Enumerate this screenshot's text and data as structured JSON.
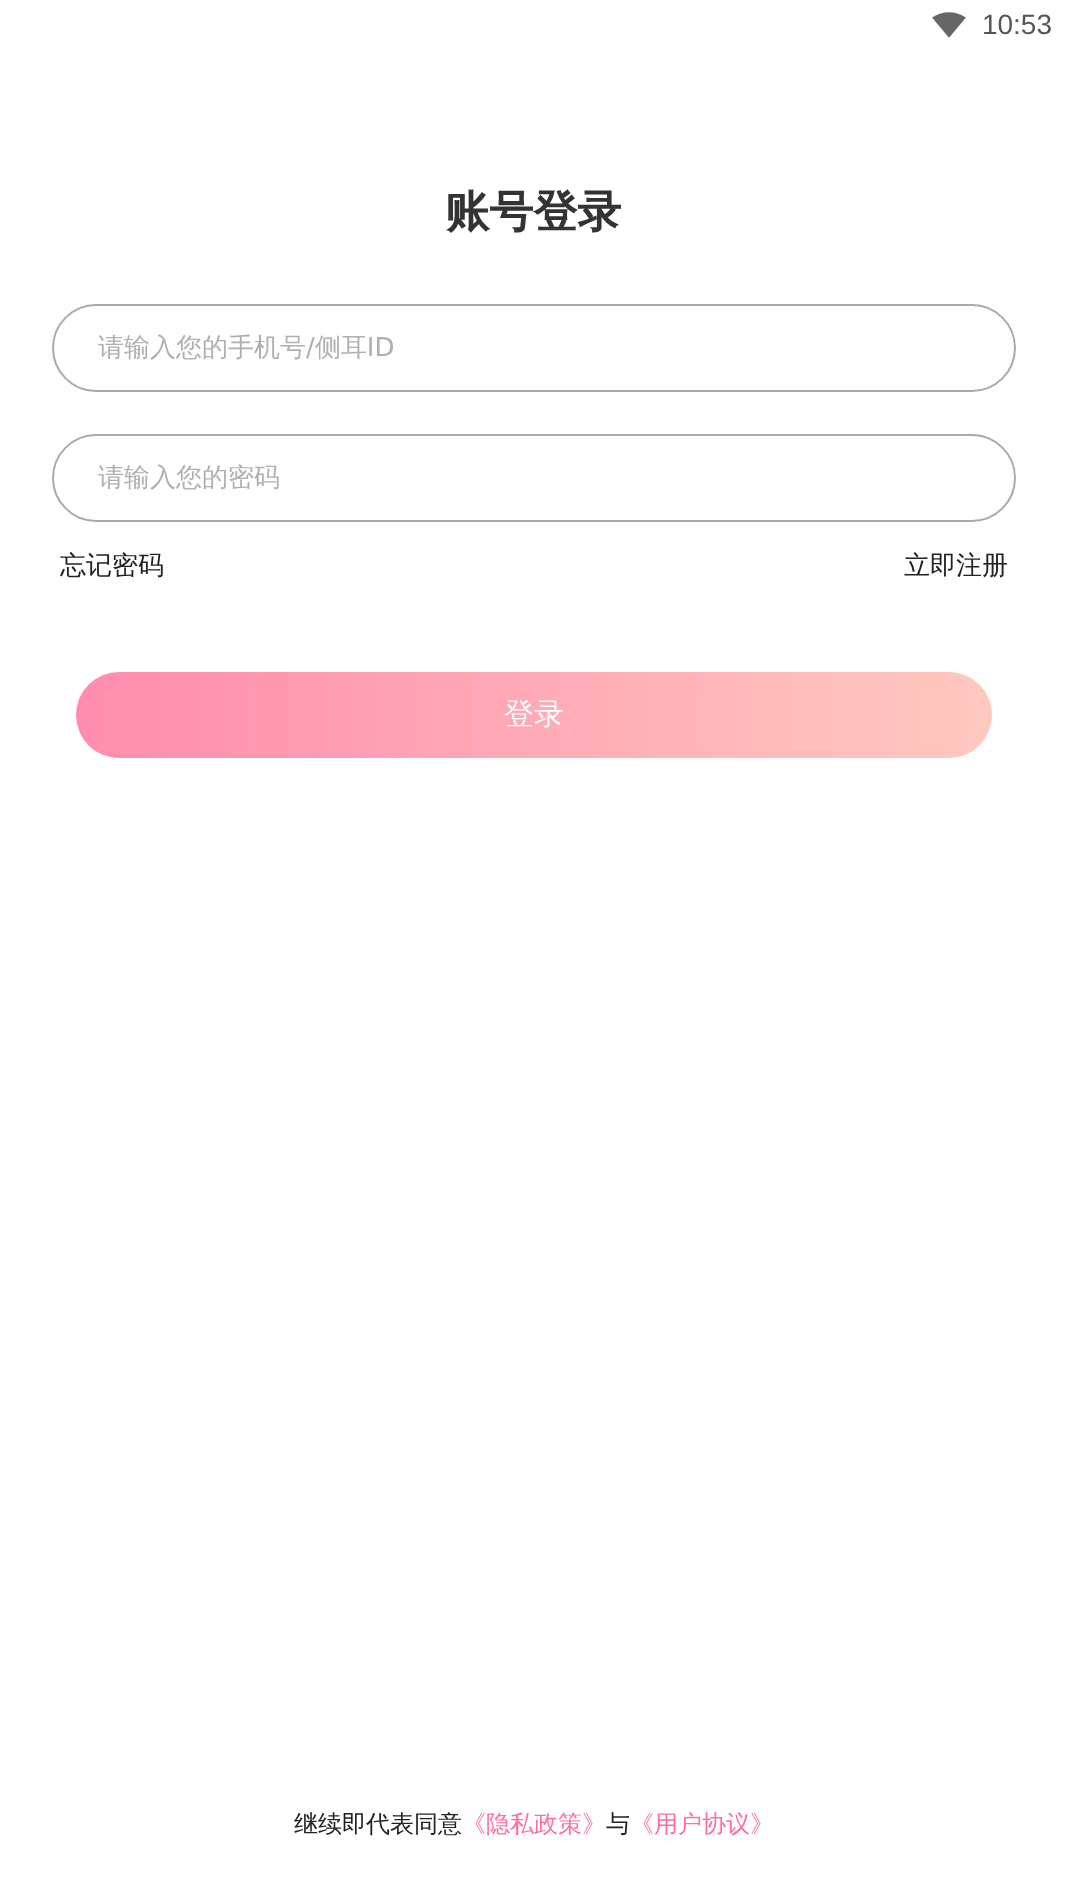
{
  "status_bar": {
    "time": "10:53"
  },
  "title": "账号登录",
  "fields": [
    {
      "placeholder": "请输入您的手机号/侧耳ID"
    },
    {
      "placeholder": "请输入您的密码"
    }
  ],
  "links": {
    "forgot": "忘记密码",
    "register": "立即注册"
  },
  "login_button": "登录",
  "agreement": {
    "prefix": "继续即代表同意",
    "privacy": "《隐私政策》",
    "joiner": "与",
    "terms": "《用户协议》"
  }
}
